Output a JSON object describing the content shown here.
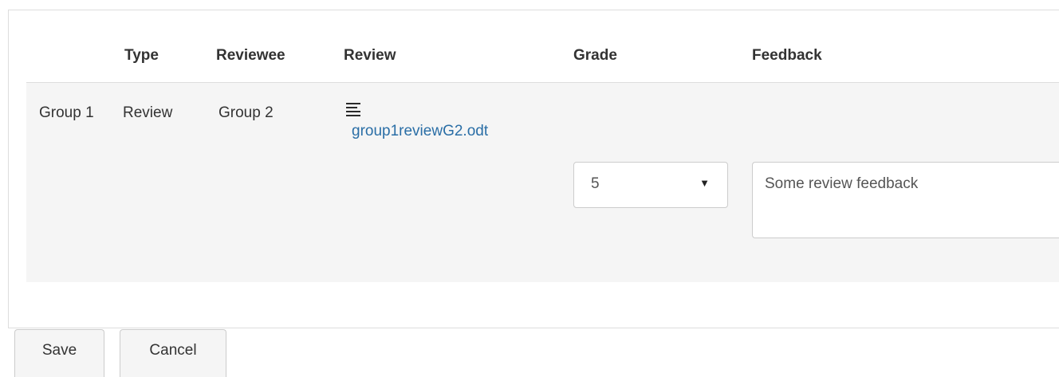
{
  "table": {
    "headers": {
      "group": "",
      "type": "Type",
      "reviewee": "Reviewee",
      "review": "Review",
      "grade": "Grade",
      "feedback": "Feedback"
    },
    "rows": [
      {
        "group": "Group 1",
        "type": "Review",
        "reviewee": "Group 2",
        "review_icon": "document-lines-icon",
        "review_file": "group1reviewG2.odt",
        "grade_selected": "5",
        "feedback": "Some review feedback"
      }
    ]
  },
  "actions": {
    "save_label": "Save",
    "cancel_label": "Cancel"
  },
  "colors": {
    "link": "#2a6ea6",
    "row_background": "#f5f5f5",
    "border": "#dddddd"
  }
}
